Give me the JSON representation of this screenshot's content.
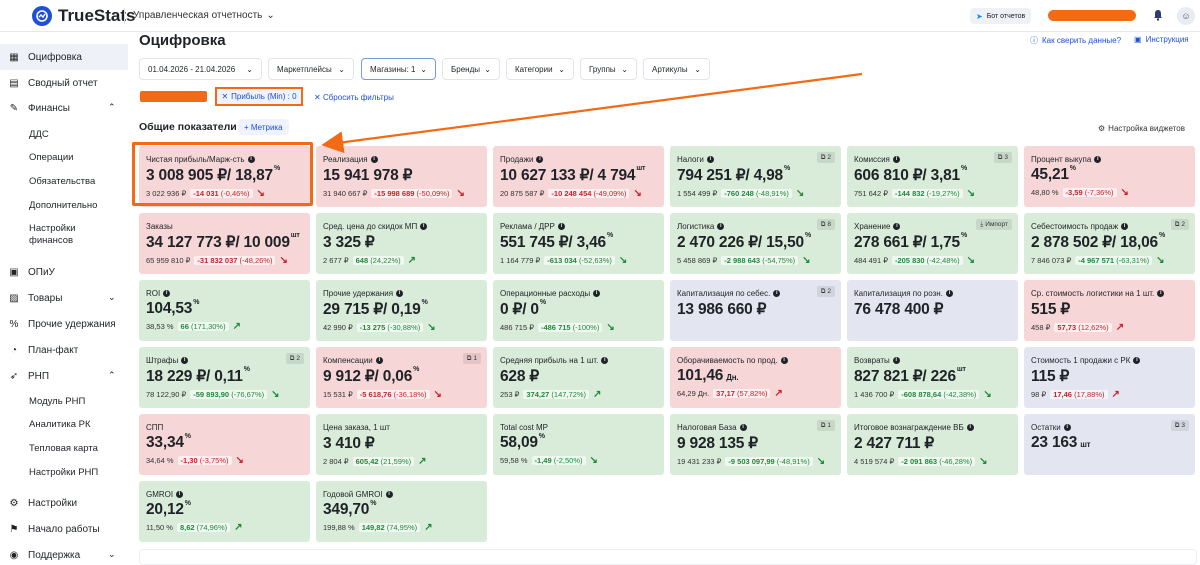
{
  "app": {
    "brand": "TrueStats",
    "report_selector": "Управленческая отчетность",
    "bot_button": "Бот отчетов",
    "user_icon": "user-icon"
  },
  "sidebar": {
    "items": [
      {
        "label": "Оцифровка",
        "icon": "grid-icon"
      },
      {
        "label": "Сводный отчет",
        "icon": "report-icon"
      },
      {
        "label": "Финансы",
        "icon": "finance-icon"
      },
      {
        "label": "ОПиУ",
        "icon": "pnl-icon"
      },
      {
        "label": "Товары",
        "icon": "box-icon"
      },
      {
        "label": "Прочие удержания",
        "icon": "percent-icon"
      },
      {
        "label": "План-факт",
        "icon": "plan-icon"
      },
      {
        "label": "РНП",
        "icon": "rocket-icon"
      },
      {
        "label": "Настройки",
        "icon": "gear-icon"
      },
      {
        "label": "Начало работы",
        "icon": "flag-icon"
      },
      {
        "label": "Поддержка",
        "icon": "support-icon"
      }
    ],
    "finance_sub": [
      "ДДС",
      "Операции",
      "Обязательства",
      "Дополнительно",
      "Настройки финансов"
    ],
    "rnp_sub": [
      "Модуль РНП",
      "Аналитика РК",
      "Тепловая карта",
      "Настройки РНП"
    ]
  },
  "header": {
    "title": "Оцифровка",
    "link_check": "Как сверить данные?",
    "link_help": "Инструкция"
  },
  "filters": [
    {
      "label": "01.04.2026 - 21.04.2026"
    },
    {
      "label": "Маркетплейсы"
    },
    {
      "label": "Магазины: 1"
    },
    {
      "label": "Бренды"
    },
    {
      "label": "Категории"
    },
    {
      "label": "Группы"
    },
    {
      "label": "Артикулы"
    }
  ],
  "active_chip": "Прибыль (Min) : 0",
  "reset_label": "Сбросить фильтры",
  "section_title": "Общие показатели",
  "metric_button": "+ Метрика",
  "widget_settings": "Настройка виджетов",
  "cards": [
    {
      "color": "red",
      "title": "Чистая прибыль/Марж-сть",
      "value": "3 008 905 ₽/ 18,87",
      "sup": "%",
      "prev": "3 022 936 ₽",
      "d1": "-14 031",
      "d2": "(-0,46%)",
      "sign": "neg",
      "arrow": "down"
    },
    {
      "color": "red",
      "title": "Реализация",
      "value": "15 941 978 ₽",
      "sup": "",
      "prev": "31 940 667 ₽",
      "d1": "-15 998 689",
      "d2": "(-50,09%)",
      "sign": "neg",
      "arrow": "down"
    },
    {
      "color": "red",
      "title": "Продажи",
      "value": "10 627 133 ₽/ 4 794",
      "sup": "шт",
      "prev": "20 875 587 ₽",
      "d1": "-10 248 454",
      "d2": "(-49,09%)",
      "sign": "neg",
      "arrow": "down"
    },
    {
      "color": "green",
      "title": "Налоги",
      "badge": "2",
      "value": "794 251 ₽/ 4,98",
      "sup": "%",
      "prev": "1 554 499 ₽",
      "d1": "-760 248",
      "d2": "(-48,91%)",
      "sign": "pos",
      "arrow": "down-green"
    },
    {
      "color": "green",
      "title": "Комиссия",
      "badge": "3",
      "value": "606 810 ₽/ 3,81",
      "sup": "%",
      "prev": "751 642 ₽",
      "d1": "-144 832",
      "d2": "(-19,27%)",
      "sign": "pos",
      "arrow": "down-green"
    },
    {
      "color": "red",
      "title": "Процент выкупа",
      "value": "45,21",
      "sup": "%",
      "prev": "48,80 %",
      "d1": "-3,59",
      "d2": "(-7,36%)",
      "sign": "neg",
      "arrow": "down"
    },
    {
      "color": "red",
      "title": "Заказы",
      "noinfo": true,
      "value": "34 127 773 ₽/ 10 009",
      "sup": "шт",
      "prev": "65 959 810 ₽",
      "d1": "-31 832 037",
      "d2": "(-48,26%)",
      "sign": "neg",
      "arrow": "down"
    },
    {
      "color": "green",
      "title": "Сред. цена до скидок МП",
      "value": "3 325 ₽",
      "sup": "",
      "prev": "2 677 ₽",
      "d1": "648",
      "d2": "(24,22%)",
      "sign": "pos",
      "arrow": "up"
    },
    {
      "color": "green",
      "title": "Реклама / ДРР",
      "value": "551 745 ₽/ 3,46",
      "sup": "%",
      "prev": "1 164 779 ₽",
      "d1": "-613 034",
      "d2": "(-52,63%)",
      "sign": "pos",
      "arrow": "down-green"
    },
    {
      "color": "green",
      "title": "Логистика",
      "badge": "8",
      "value": "2 470 226 ₽/ 15,50",
      "sup": "%",
      "prev": "5 458 869 ₽",
      "d1": "-2 988 643",
      "d2": "(-54,75%)",
      "sign": "pos",
      "arrow": "down-green"
    },
    {
      "color": "green",
      "title": "Хранение",
      "badge": "Импорт",
      "value": "278 661 ₽/ 1,75",
      "sup": "%",
      "prev": "484 491 ₽",
      "d1": "-205 830",
      "d2": "(-42,48%)",
      "sign": "pos",
      "arrow": "down-green"
    },
    {
      "color": "green",
      "title": "Себестоимость продаж",
      "badge": "2",
      "value": "2 878 502 ₽/ 18,06",
      "sup": "%",
      "prev": "7 846 073 ₽",
      "d1": "-4 967 571",
      "d2": "(-63,31%)",
      "sign": "pos",
      "arrow": "down-green"
    },
    {
      "color": "green",
      "title": "ROI",
      "value": "104,53",
      "sup": "%",
      "prev": "38,53 %",
      "d1": "66",
      "d2": "(171,30%)",
      "sign": "pos",
      "arrow": "up"
    },
    {
      "color": "green",
      "title": "Прочие удержания",
      "value": "29 715 ₽/ 0,19",
      "sup": "%",
      "prev": "42 990 ₽",
      "d1": "-13 275",
      "d2": "(-30,88%)",
      "sign": "pos",
      "arrow": "down-green"
    },
    {
      "color": "green",
      "title": "Операционные расходы",
      "value": "0 ₽/ 0",
      "sup": "%",
      "prev": "486 715 ₽",
      "d1": "-486 715",
      "d2": "(-100%)",
      "sign": "pos",
      "arrow": "down-green"
    },
    {
      "color": "blue",
      "title": "Капитализация по себес.",
      "badge": "2",
      "value": "13 986 660 ₽",
      "sup": "",
      "prev": "",
      "d1": "",
      "d2": "",
      "sign": "",
      "arrow": ""
    },
    {
      "color": "blue",
      "title": "Капитализация по розн.",
      "value": "76 478 400 ₽",
      "sup": "",
      "prev": "",
      "d1": "",
      "d2": "",
      "sign": "",
      "arrow": ""
    },
    {
      "color": "red",
      "title": "Ср. стоимость логистики на 1 шт.",
      "value": "515 ₽",
      "sup": "",
      "prev": "458 ₽",
      "d1": "57,73",
      "d2": "(12,62%)",
      "sign": "neg",
      "arrow": "up-red"
    },
    {
      "color": "green",
      "title": "Штрафы",
      "badge": "2",
      "value": "18 229 ₽/ 0,11",
      "sup": "%",
      "prev": "78 122,90 ₽",
      "d1": "-59 893,90",
      "d2": "(-76,67%)",
      "sign": "pos",
      "arrow": "down-green"
    },
    {
      "color": "red",
      "title": "Компенсации",
      "badge": "1",
      "value": "9 912 ₽/ 0,06",
      "sup": "%",
      "prev": "15 531 ₽",
      "d1": "-5 618,76",
      "d2": "(-36,18%)",
      "sign": "neg",
      "arrow": "down"
    },
    {
      "color": "green",
      "title": "Средняя прибыль на 1 шт.",
      "value": "628 ₽",
      "sup": "",
      "prev": "253 ₽",
      "d1": "374,27",
      "d2": "(147,72%)",
      "sign": "pos",
      "arrow": "up"
    },
    {
      "color": "red",
      "title": "Оборачиваемость по прод.",
      "value": "101,46",
      "unit": "Дн.",
      "sup": "",
      "prev": "64,29 Дн.",
      "d1": "37,17",
      "d2": "(57,82%)",
      "sign": "neg",
      "arrow": "up-red"
    },
    {
      "color": "green",
      "title": "Возвраты",
      "value": "827 821 ₽/ 226",
      "sup": "шт",
      "prev": "1 436 700 ₽",
      "d1": "-608 878,64",
      "d2": "(-42,38%)",
      "sign": "pos",
      "arrow": "down-green"
    },
    {
      "color": "blue",
      "title": "Стоимость 1 продажи с РК",
      "value": "115 ₽",
      "sup": "",
      "prev": "98 ₽",
      "d1": "17,46",
      "d2": "(17,88%)",
      "sign": "neg",
      "arrow": "up-red"
    },
    {
      "color": "red",
      "title": "СПП",
      "noinfo": true,
      "value": "33,34",
      "sup": "%",
      "prev": "34,64 %",
      "d1": "-1,30",
      "d2": "(-3,75%)",
      "sign": "neg",
      "arrow": "down"
    },
    {
      "color": "green",
      "title": "Цена заказа, 1 шт",
      "noinfo": true,
      "value": "3 410 ₽",
      "sup": "",
      "prev": "2 804 ₽",
      "d1": "605,42",
      "d2": "(21,59%)",
      "sign": "pos",
      "arrow": "up"
    },
    {
      "color": "green",
      "title": "Total cost MP",
      "noinfo": true,
      "value": "58,09",
      "sup": "%",
      "prev": "59,58 %",
      "d1": "-1,49",
      "d2": "(-2,50%)",
      "sign": "pos",
      "arrow": "down-green"
    },
    {
      "color": "green",
      "title": "Налоговая База",
      "badge": "1",
      "value": "9 928 135 ₽",
      "sup": "",
      "prev": "19 431 233 ₽",
      "d1": "-9 503 097,99",
      "d2": "(-48,91%)",
      "sign": "pos",
      "arrow": "down-green"
    },
    {
      "color": "green",
      "title": "Итоговое вознаграждение ВБ",
      "value": "2 427 711 ₽",
      "sup": "",
      "prev": "4 519 574 ₽",
      "d1": "-2 091 863",
      "d2": "(-46,28%)",
      "sign": "pos",
      "arrow": "down-green"
    },
    {
      "color": "blue",
      "title": "Остатки",
      "badge": "3",
      "value": "23 163",
      "unit": "шт",
      "sup": "",
      "prev": "",
      "d1": "",
      "d2": "",
      "sign": "",
      "arrow": ""
    },
    {
      "color": "green",
      "title": "GMROI",
      "value": "20,12",
      "sup": "%",
      "prev": "11,50 %",
      "d1": "8,62",
      "d2": "(74,96%)",
      "sign": "pos",
      "arrow": "up"
    },
    {
      "color": "green",
      "title": "Годовой GMROI",
      "value": "349,70",
      "sup": "%",
      "prev": "199,88 %",
      "d1": "149,82",
      "d2": "(74,95%)",
      "sign": "pos",
      "arrow": "up"
    }
  ],
  "colors": {
    "accent": "#1e4fd8",
    "highlight": "#f26a13",
    "red_card": "#f7d6d7",
    "green_card": "#d9ebd9",
    "neutral_card": "#e3e6f0"
  }
}
